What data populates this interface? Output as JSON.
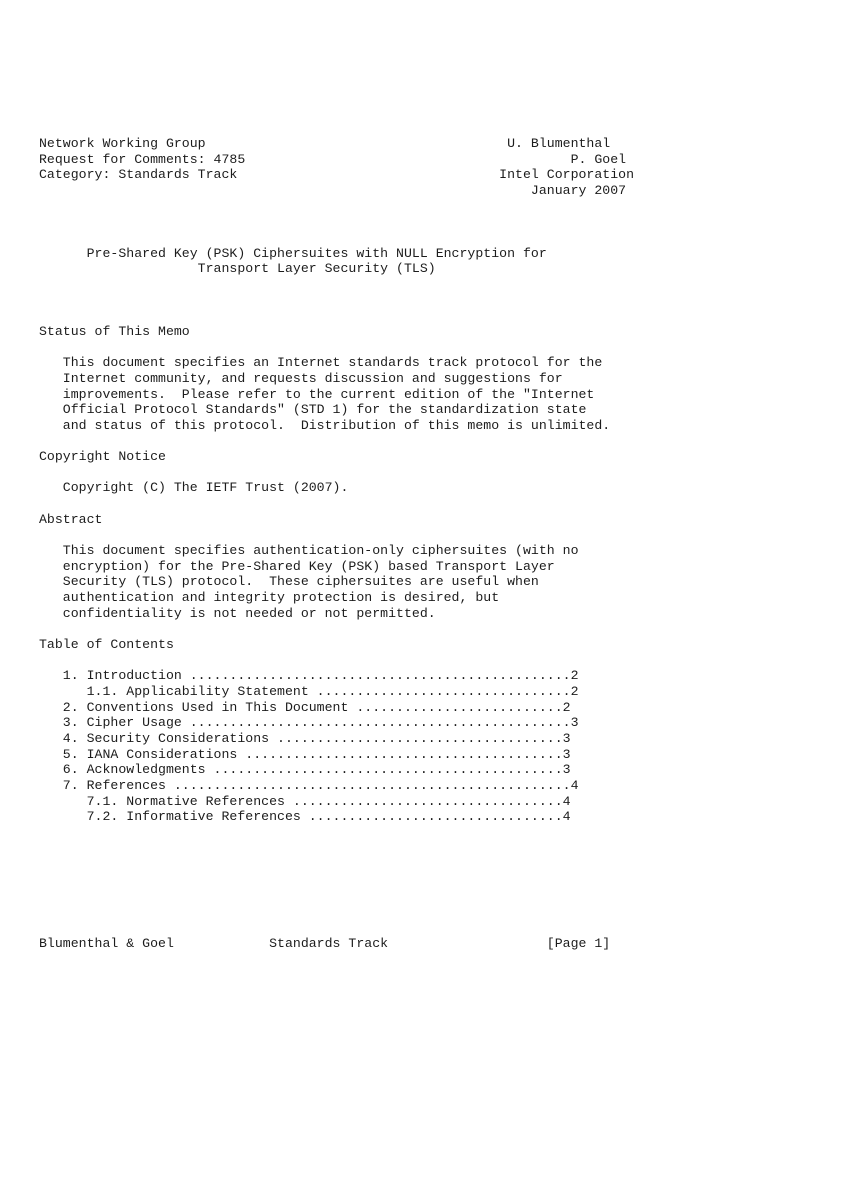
{
  "document": {
    "type": "rfc-plain-text",
    "page_width_chars": 72,
    "header": {
      "left_lines": [
        "Network Working Group",
        "Request for Comments: 4785",
        "Category: Standards Track"
      ],
      "right_lines": [
        "U. Blumenthal",
        "P. Goel",
        "Intel Corporation",
        "January 2007"
      ],
      "working_group": "Network Working Group",
      "rfc_number": "4785",
      "request_for_comments": "Request for Comments: 4785",
      "category": "Category: Standards Track",
      "author_1": "U. Blumenthal",
      "author_2": "P. Goel",
      "organization": "Intel Corporation",
      "date": "January 2007"
    },
    "title_lines": [
      "Pre-Shared Key (PSK) Ciphersuites with NULL Encryption for",
      "Transport Layer Security (TLS)"
    ],
    "sections": [
      {
        "heading": "Status of This Memo",
        "paragraphs": [
          [
            "This document specifies an Internet standards track protocol for the",
            "Internet community, and requests discussion and suggestions for",
            "improvements.  Please refer to the current edition of the \"Internet",
            "Official Protocol Standards\" (STD 1) for the standardization state",
            "and status of this protocol.  Distribution of this memo is unlimited."
          ]
        ]
      },
      {
        "heading": "Copyright Notice",
        "paragraphs": [
          [
            "Copyright (C) The IETF Trust (2007)."
          ]
        ]
      },
      {
        "heading": "Abstract",
        "paragraphs": [
          [
            "This document specifies authentication-only ciphersuites (with no",
            "encryption) for the Pre-Shared Key (PSK) based Transport Layer",
            "Security (TLS) protocol.  These ciphersuites are useful when",
            "authentication and integrity protection is desired, but",
            "confidentiality is not needed or not permitted."
          ]
        ]
      }
    ],
    "toc": {
      "heading": "Table of Contents",
      "entries": [
        {
          "number": "1.",
          "label": "Introduction",
          "page": "2",
          "level": 1,
          "line": "   1. Introduction ................................................2"
        },
        {
          "number": "1.1.",
          "label": "Applicability Statement",
          "page": "2",
          "level": 2,
          "line": "      1.1. Applicability Statement ...................................2"
        },
        {
          "number": "2.",
          "label": "Conventions Used in This Document",
          "page": "2",
          "level": 1,
          "line": "   2. Conventions Used in This Document ..................................2"
        },
        {
          "number": "3.",
          "label": "Cipher Usage",
          "page": "3",
          "level": 1,
          "line": "   3. Cipher Usage ................................................3"
        },
        {
          "number": "4.",
          "label": "Security Considerations",
          "page": "3",
          "level": 1,
          "line": "   4. Security Considerations .........................................3"
        },
        {
          "number": "5.",
          "label": "IANA Considerations",
          "page": "3",
          "level": 1,
          "line": "   5. IANA Considerations .........................................3"
        },
        {
          "number": "6.",
          "label": "Acknowledgments",
          "page": "3",
          "level": 1,
          "line": "   6. Acknowledgments .............................................3"
        },
        {
          "number": "7.",
          "label": "References",
          "page": "4",
          "level": 1,
          "line": "   7. References ..................................................4"
        },
        {
          "number": "7.1.",
          "label": "Normative References",
          "page": "4",
          "level": 2,
          "line": "      7.1. Normative References ..................................4"
        },
        {
          "number": "7.2.",
          "label": "Informative References",
          "page": "4",
          "level": 2,
          "line": "      7.2. Informative References ................................4"
        }
      ]
    },
    "footer": {
      "authors": "Blumenthal & Goel",
      "category": "Standards Track",
      "page_marker": "[Page 1]",
      "line": "Blumenthal & Goel            Standards Track                    [Page 1]"
    }
  },
  "body_text": {
    "header_block": "Network Working Group                                      U. Blumenthal\nRequest for Comments: 4785                                         P. Goel\nCategory: Standards Track                                 Intel Corporation\n                                                              January 2007",
    "title_block": "      Pre-Shared Key (PSK) Ciphersuites with NULL Encryption for\n                    Transport Layer Security (TLS)",
    "status_heading": "Status of This Memo",
    "status_body": "   This document specifies an Internet standards track protocol for the\n   Internet community, and requests discussion and suggestions for\n   improvements.  Please refer to the current edition of the \"Internet\n   Official Protocol Standards\" (STD 1) for the standardization state\n   and status of this protocol.  Distribution of this memo is unlimited.",
    "copyright_heading": "Copyright Notice",
    "copyright_body": "   Copyright (C) The IETF Trust (2007).",
    "abstract_heading": "Abstract",
    "abstract_body": "   This document specifies authentication-only ciphersuites (with no\n   encryption) for the Pre-Shared Key (PSK) based Transport Layer\n   Security (TLS) protocol.  These ciphersuites are useful when\n   authentication and integrity protection is desired, but\n   confidentiality is not needed or not permitted.",
    "toc_heading": "Table of Contents",
    "toc_body": "   1. Introduction ................................................2\n      1.1. Applicability Statement ................................2\n   2. Conventions Used in This Document ..........................2\n   3. Cipher Usage ................................................3\n   4. Security Considerations ....................................3\n   5. IANA Considerations ........................................3\n   6. Acknowledgments ............................................3\n   7. References ..................................................4\n      7.1. Normative References ..................................4\n      7.2. Informative References ................................4",
    "footer_line": "Blumenthal & Goel            Standards Track                    [Page 1]"
  }
}
